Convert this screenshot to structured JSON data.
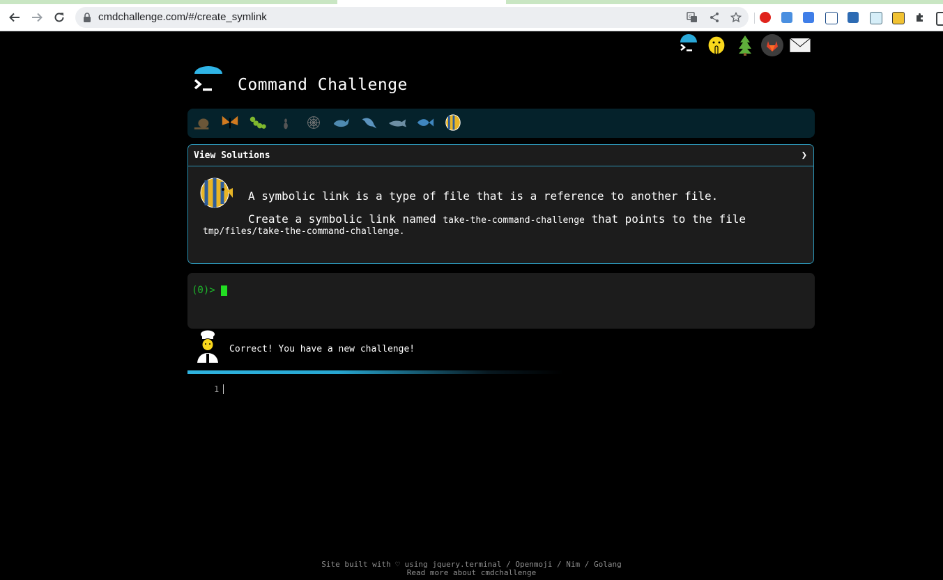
{
  "browser": {
    "url": "cmdchallenge.com/#/create_symlink",
    "extension_icons": [
      "opera-icon",
      "window-icon",
      "translate-ext-icon",
      "languagetool-icon",
      "box-icon",
      "eyedropper-icon",
      "terminal-ext-icon",
      "puzzle-icon",
      "sidebar-icon"
    ]
  },
  "header": {
    "title": "Command Challenge",
    "top_icons": [
      "terminal-icon",
      "shushing-face-icon",
      "tree-icon",
      "gitlab-icon",
      "envelope-icon"
    ]
  },
  "levels": [
    "snail-icon",
    "butterfly-icon",
    "caterpillar-icon",
    "ant-icon",
    "web-icon",
    "whale-icon",
    "dolphin-icon",
    "shark-icon",
    "fish-icon",
    "tropical-fish-icon"
  ],
  "challenge": {
    "header_label": "View Solutions",
    "chevron": "❯",
    "line1": "A symbolic link is a type of file that is a reference to another file.",
    "line2_prefix": "Create a symbolic link named",
    "link_name": "take-the-command-challenge",
    "line2_suffix": "that points to the file",
    "target_path": "tmp/files/take-the-command-challenge",
    "period": "."
  },
  "terminal": {
    "prompt": "(0)>"
  },
  "feedback": {
    "message": "Correct! You have a new challenge!"
  },
  "editor": {
    "line_number": "1"
  },
  "footer": {
    "line1": "Site built with ♡ using jquery.terminal / Openmoji / Nim / Golang",
    "line2": "Read more about cmdchallenge"
  }
}
